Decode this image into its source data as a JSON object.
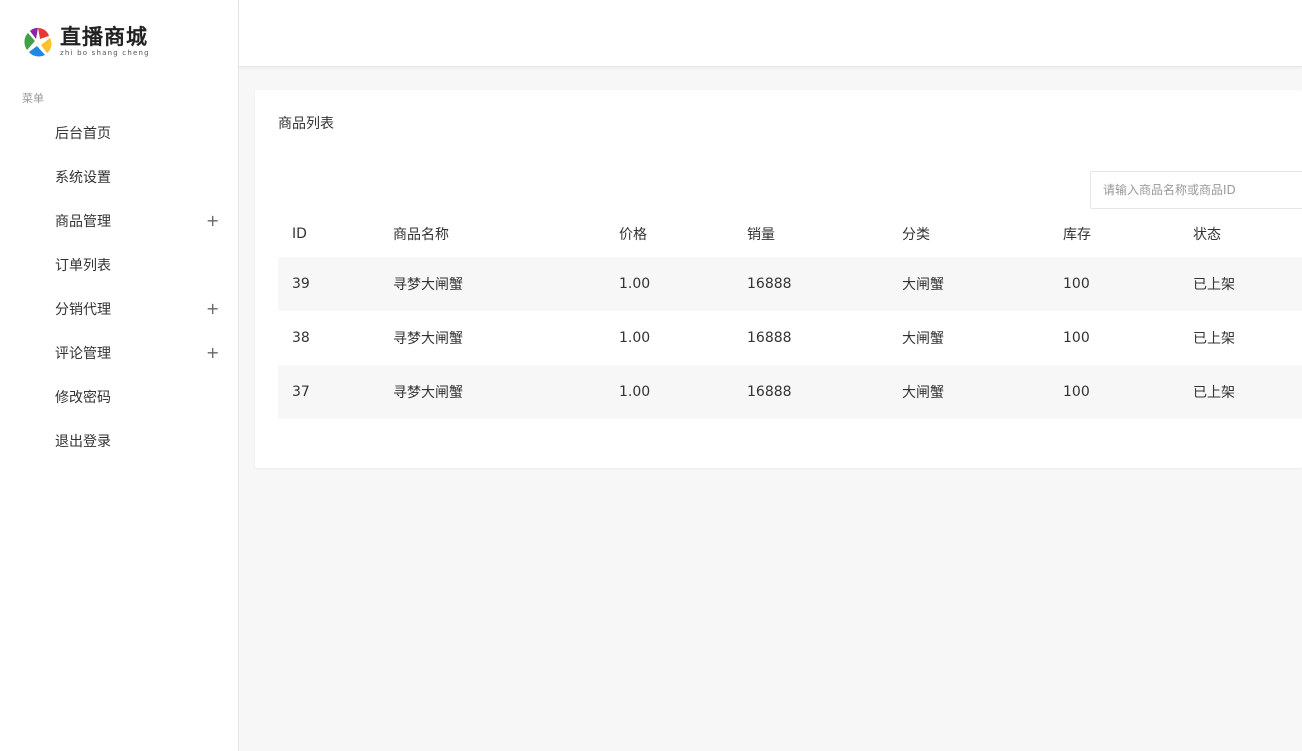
{
  "brand": {
    "title": "直播商城",
    "subtitle": "zhi bo shang cheng"
  },
  "sidebar": {
    "menu_title": "菜单",
    "items": [
      {
        "label": "后台首页"
      },
      {
        "label": "系统设置"
      },
      {
        "label": "商品管理",
        "expandable": true
      },
      {
        "label": "订单列表"
      },
      {
        "label": "分销代理",
        "expandable": true
      },
      {
        "label": "评论管理",
        "expandable": true
      },
      {
        "label": "修改密码"
      },
      {
        "label": "退出登录"
      }
    ],
    "expand_symbol": "+"
  },
  "main": {
    "card_title": "商品列表",
    "search_placeholder": "请输入商品名称或商品ID",
    "table": {
      "headers": [
        "ID",
        "商品名称",
        "价格",
        "销量",
        "分类",
        "库存",
        "状态"
      ],
      "rows": [
        [
          "39",
          "寻梦大闸蟹",
          "1.00",
          "16888",
          "大闸蟹",
          "100",
          "已上架"
        ],
        [
          "38",
          "寻梦大闸蟹",
          "1.00",
          "16888",
          "大闸蟹",
          "100",
          "已上架"
        ],
        [
          "37",
          "寻梦大闸蟹",
          "1.00",
          "16888",
          "大闸蟹",
          "100",
          "已上架"
        ]
      ]
    }
  },
  "colors": {
    "status_on": "#5fb878",
    "sidebar_bg": "#ffffff",
    "content_bg": "#f7f7f7"
  }
}
